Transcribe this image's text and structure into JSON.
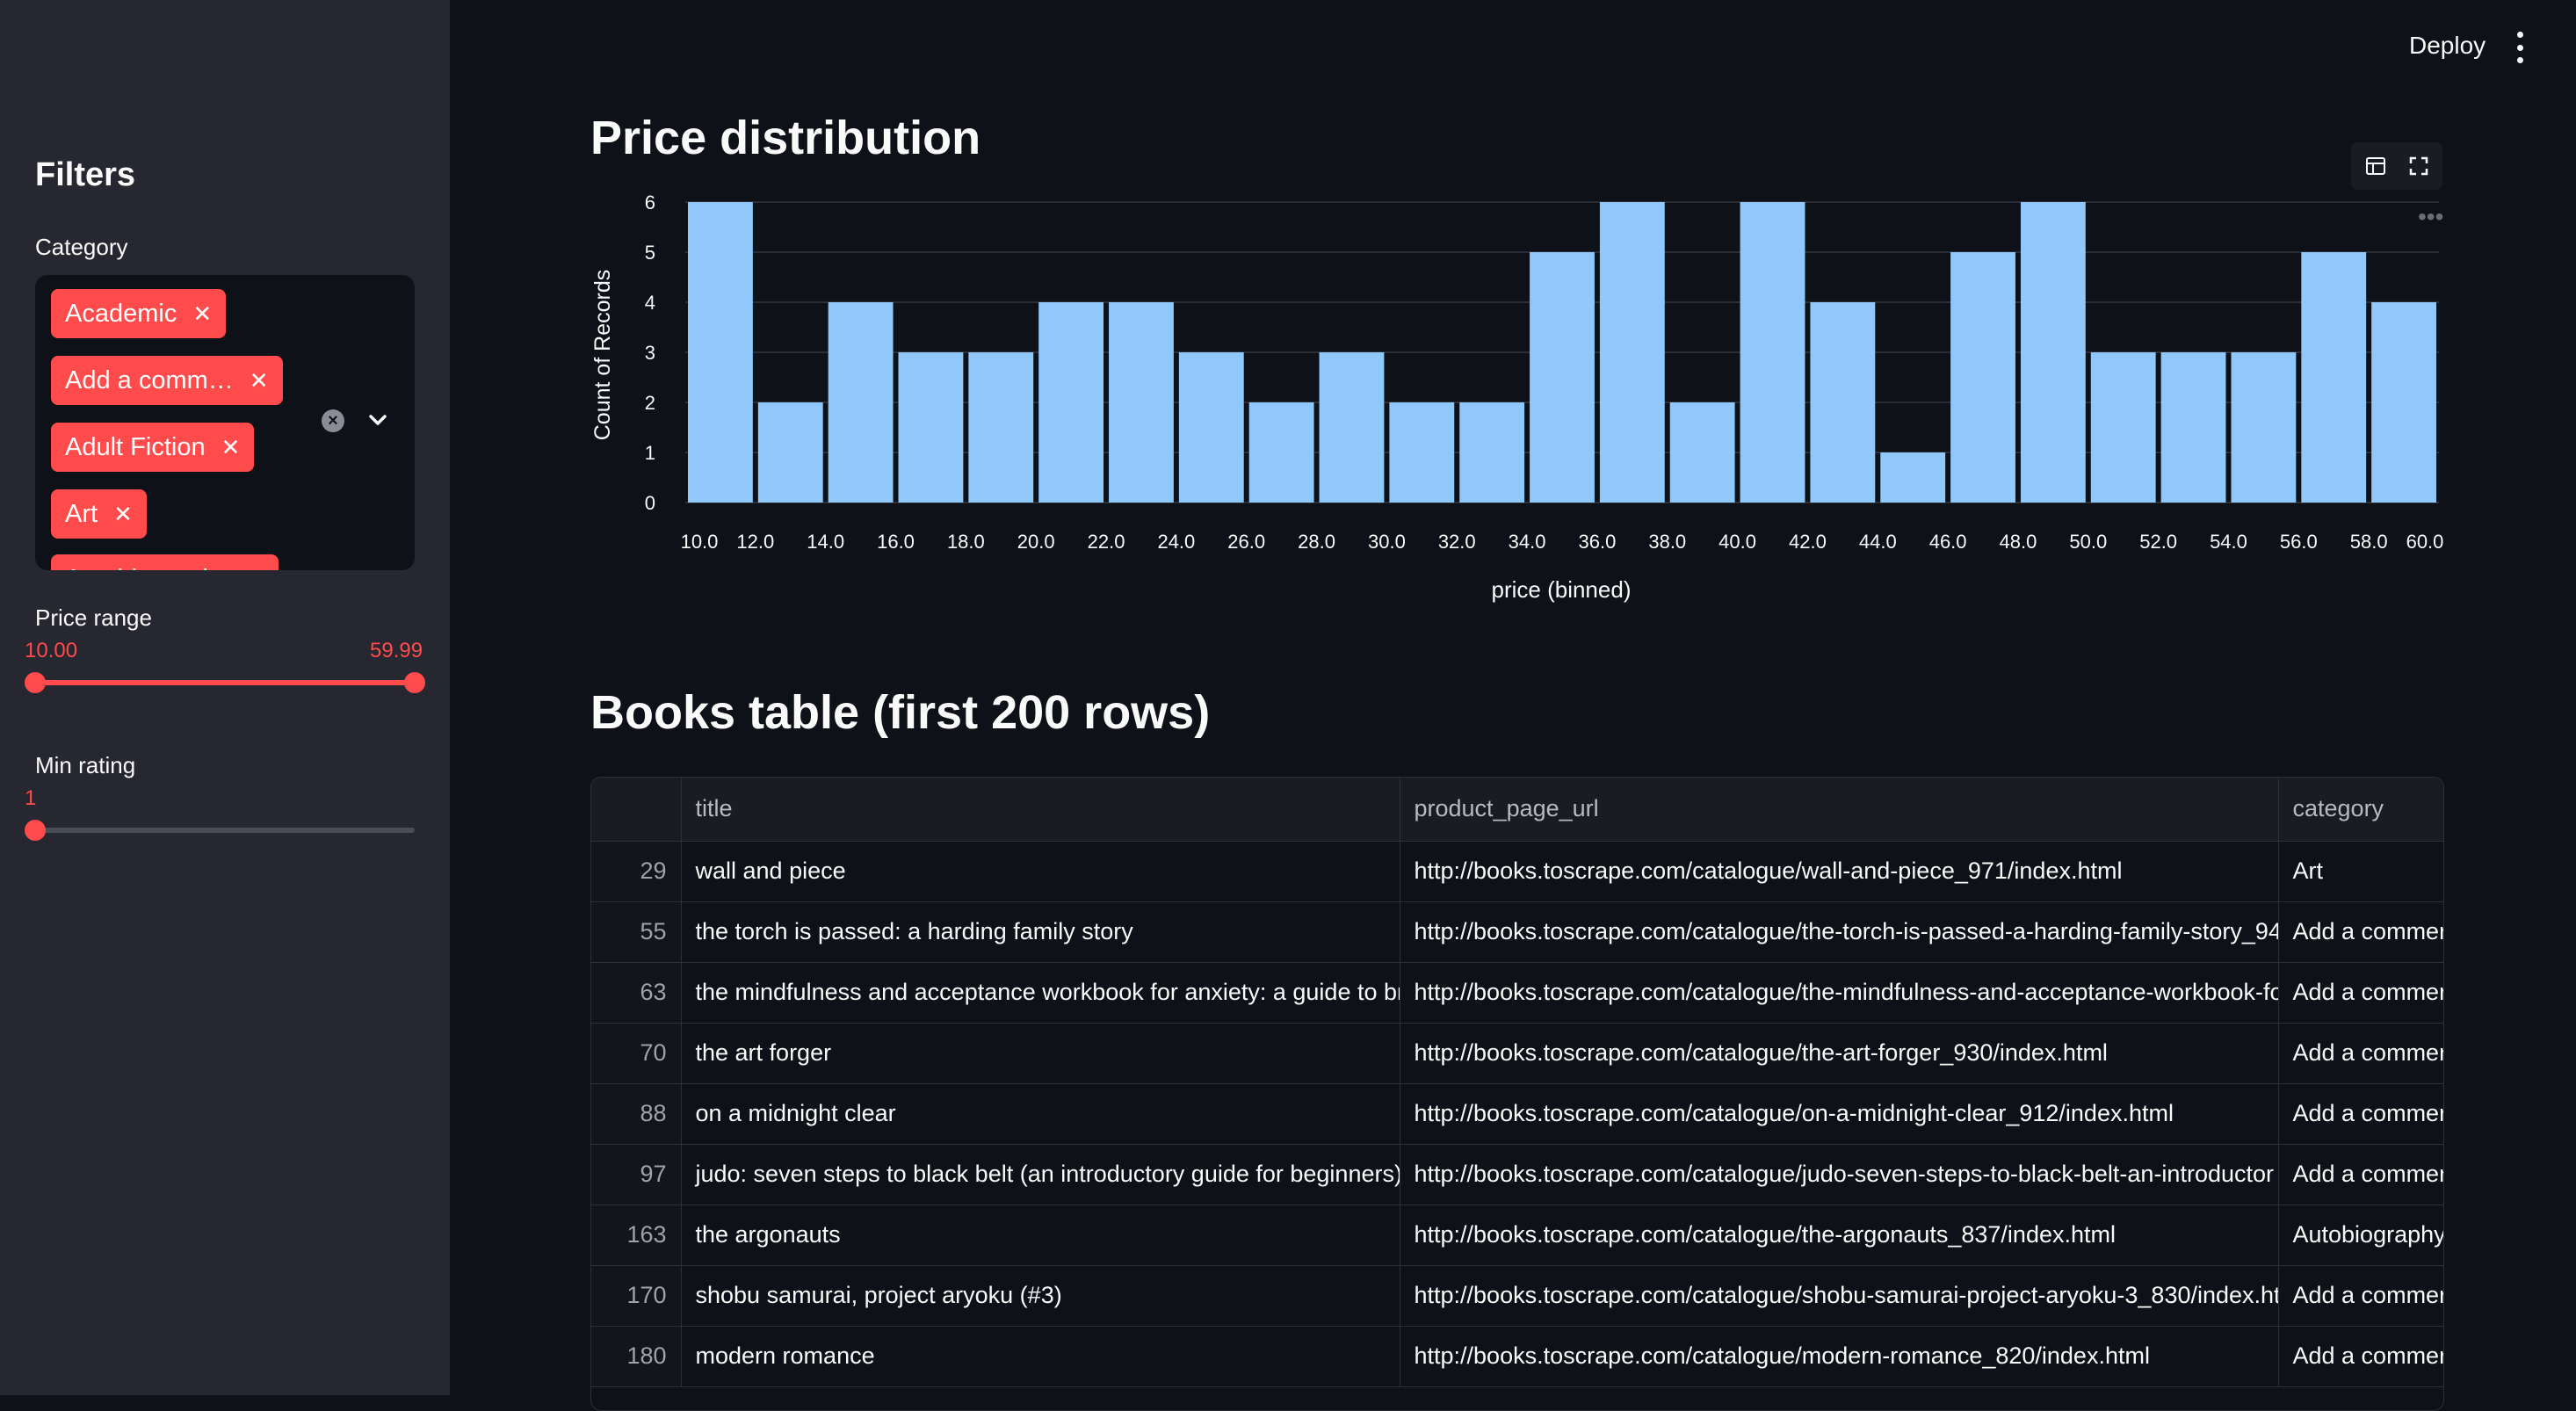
{
  "header": {
    "deploy_label": "Deploy"
  },
  "sidebar": {
    "title": "Filters",
    "category_label": "Category",
    "category_selected": [
      "Academic",
      "Add a comm…",
      "Adult Fiction",
      "Art",
      "Autobiography"
    ],
    "price_label": "Price range",
    "price_min": "10.00",
    "price_max": "59.99",
    "rating_label": "Min rating",
    "rating_value": "1"
  },
  "main": {
    "chart_heading": "Price distribution",
    "table_heading": "Books table (first 200 rows)"
  },
  "chart_data": {
    "type": "bar",
    "xlabel": "price (binned)",
    "ylabel": "Count of Records",
    "ylim": [
      0,
      6
    ],
    "yticks": [
      "0",
      "1",
      "2",
      "3",
      "4",
      "5",
      "6"
    ],
    "xticks": [
      "10.0",
      "12.0",
      "14.0",
      "16.0",
      "18.0",
      "20.0",
      "22.0",
      "24.0",
      "26.0",
      "28.0",
      "30.0",
      "32.0",
      "34.0",
      "36.0",
      "38.0",
      "40.0",
      "42.0",
      "44.0",
      "46.0",
      "48.0",
      "50.0",
      "52.0",
      "54.0",
      "56.0",
      "58.0",
      "60.0"
    ],
    "bins": [
      [
        10,
        12
      ],
      [
        12,
        14
      ],
      [
        14,
        16
      ],
      [
        16,
        18
      ],
      [
        18,
        20
      ],
      [
        20,
        22
      ],
      [
        22,
        24
      ],
      [
        24,
        26
      ],
      [
        26,
        28
      ],
      [
        28,
        30
      ],
      [
        30,
        32
      ],
      [
        32,
        34
      ],
      [
        34,
        36
      ],
      [
        36,
        38
      ],
      [
        38,
        40
      ],
      [
        40,
        42
      ],
      [
        42,
        44
      ],
      [
        44,
        46
      ],
      [
        46,
        48
      ],
      [
        48,
        50
      ],
      [
        50,
        52
      ],
      [
        52,
        54
      ],
      [
        54,
        56
      ],
      [
        56,
        58
      ],
      [
        58,
        60
      ]
    ],
    "values": [
      6,
      2,
      4,
      3,
      3,
      4,
      4,
      3,
      2,
      3,
      2,
      2,
      5,
      6,
      2,
      6,
      4,
      1,
      5,
      6,
      3,
      3,
      3,
      5,
      4
    ],
    "color": "#90c8fb",
    "grid": true
  },
  "table": {
    "columns": [
      "title",
      "product_page_url",
      "category"
    ],
    "rows": [
      {
        "idx": "29",
        "title": "wall and piece",
        "url": "http://books.toscrape.com/catalogue/wall-and-piece_971/index.html",
        "category": "Art"
      },
      {
        "idx": "55",
        "title": "the torch is passed: a harding family story",
        "url": "http://books.toscrape.com/catalogue/the-torch-is-passed-a-harding-family-story_94",
        "category": "Add a commer"
      },
      {
        "idx": "63",
        "title": "the mindfulness and acceptance workbook for anxiety: a guide to bre",
        "url": "http://books.toscrape.com/catalogue/the-mindfulness-and-acceptance-workbook-fo",
        "category": "Add a commer"
      },
      {
        "idx": "70",
        "title": "the art forger",
        "url": "http://books.toscrape.com/catalogue/the-art-forger_930/index.html",
        "category": "Add a commer"
      },
      {
        "idx": "88",
        "title": "on a midnight clear",
        "url": "http://books.toscrape.com/catalogue/on-a-midnight-clear_912/index.html",
        "category": "Add a commer"
      },
      {
        "idx": "97",
        "title": "judo: seven steps to black belt (an introductory guide for beginners)",
        "url": "http://books.toscrape.com/catalogue/judo-seven-steps-to-black-belt-an-introductor",
        "category": "Add a commer"
      },
      {
        "idx": "163",
        "title": "the argonauts",
        "url": "http://books.toscrape.com/catalogue/the-argonauts_837/index.html",
        "category": "Autobiography"
      },
      {
        "idx": "170",
        "title": "shobu samurai, project aryoku (#3)",
        "url": "http://books.toscrape.com/catalogue/shobu-samurai-project-aryoku-3_830/index.ht",
        "category": "Add a commer"
      },
      {
        "idx": "180",
        "title": "modern romance",
        "url": "http://books.toscrape.com/catalogue/modern-romance_820/index.html",
        "category": "Add a commer"
      }
    ]
  },
  "colors": {
    "accent": "#ff4b4b",
    "bar": "#90c8fb",
    "background": "#0e1117",
    "sidebar": "#262730"
  },
  "icons": [
    "close-icon",
    "clear-icon",
    "chevron-down-icon",
    "kebab-menu-icon",
    "table-view-icon",
    "fullscreen-icon",
    "more-icon"
  ]
}
